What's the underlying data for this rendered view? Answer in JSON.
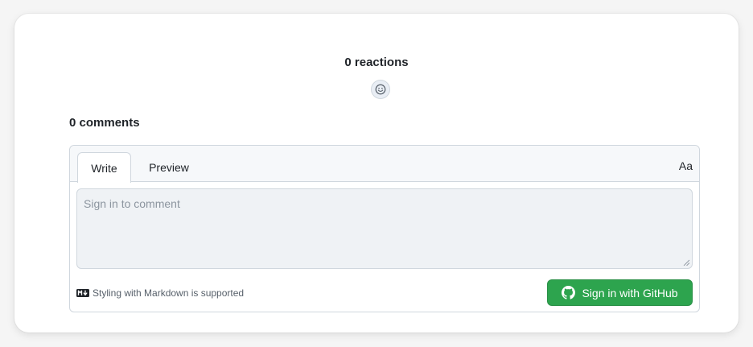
{
  "reactions": {
    "title": "0 reactions",
    "add_reaction_icon": "smiley-icon"
  },
  "comments": {
    "title": "0 comments"
  },
  "editor": {
    "tabs": [
      {
        "label": "Write",
        "active": true
      },
      {
        "label": "Preview",
        "active": false
      }
    ],
    "format_label": "Aa",
    "textarea_placeholder": "Sign in to comment",
    "markdown_note": "Styling with Markdown is supported",
    "markdown_icon": "markdown-icon",
    "signin_button": "Sign in with GitHub",
    "signin_icon": "github-icon"
  },
  "colors": {
    "accent_green": "#2da44e",
    "border": "#d0d7de",
    "placeholder": "#8c959f"
  }
}
